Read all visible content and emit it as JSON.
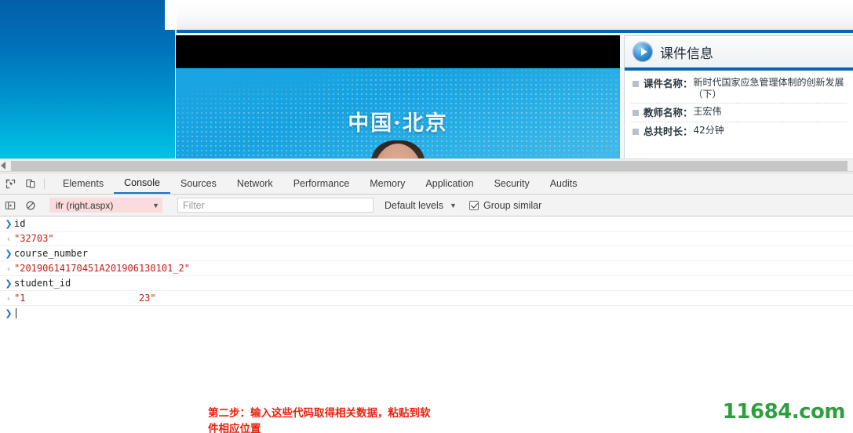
{
  "webpage": {
    "video": {
      "slide_title": "中国·北京"
    },
    "course_info": {
      "panel_title": "课件信息",
      "play_icon": "play-circle-icon",
      "rows": [
        {
          "label": "课件名称：",
          "value": "新时代国家应急管理体制的创新发展（下）"
        },
        {
          "label": "教师名称：",
          "value": "王宏伟"
        },
        {
          "label": "总共时长：",
          "value": "42分钟"
        }
      ]
    }
  },
  "devtools": {
    "toolbar_icons": [
      {
        "name": "inspect-element-icon"
      },
      {
        "name": "device-toolbar-icon"
      }
    ],
    "tabs": [
      {
        "label": "Elements",
        "selected": false
      },
      {
        "label": "Console",
        "selected": true
      },
      {
        "label": "Sources",
        "selected": false
      },
      {
        "label": "Network",
        "selected": false
      },
      {
        "label": "Performance",
        "selected": false
      },
      {
        "label": "Memory",
        "selected": false
      },
      {
        "label": "Application",
        "selected": false
      },
      {
        "label": "Security",
        "selected": false
      },
      {
        "label": "Audits",
        "selected": false
      }
    ],
    "filterbar": {
      "sidebar_toggle_icon": "console-sidebar-icon",
      "clear_icon": "clear-console-icon",
      "context_value": "ifr (right.aspx)",
      "context_caret": "▼",
      "filter_placeholder": "Filter",
      "filter_value": "",
      "levels_label": "Default levels",
      "levels_caret": "▼",
      "group_similar_label": "Group similar",
      "group_similar_checked": true
    },
    "console_rows": [
      {
        "kind": "input",
        "marker": "❯",
        "text": "id"
      },
      {
        "kind": "output",
        "marker": "‹",
        "text": "\"32703\""
      },
      {
        "kind": "input",
        "marker": "❯",
        "text": "course_number"
      },
      {
        "kind": "output",
        "marker": "‹",
        "text": "\"20190614170451A201906130101_2\""
      },
      {
        "kind": "input",
        "marker": "❯",
        "text": "student_id"
      },
      {
        "kind": "output",
        "marker": "output-redacted",
        "marker_glyph": "‹",
        "prefix": "\"1",
        "masked": "                    ",
        "suffix": "23\""
      },
      {
        "kind": "prompt",
        "marker": "❯",
        "text": ""
      }
    ]
  },
  "annotation": {
    "line1": "第二步：输入这些代码取得相关数据，粘贴到软",
    "line2": "件相应位置",
    "color": "#e8220f"
  },
  "watermark": {
    "text": "11684.com",
    "color": "#2f9e3f"
  },
  "colors": {
    "devtools_chrome": "#f3f3f3",
    "tab_selected_underline": "#1a73c8",
    "context_pill": "#fbdcdc",
    "console_value_red": "#c41a16",
    "page_accent_blue": "#0a66ad",
    "sidebar_gradient_top": "#035fa8",
    "sidebar_gradient_bottom": "#00c3e0"
  }
}
